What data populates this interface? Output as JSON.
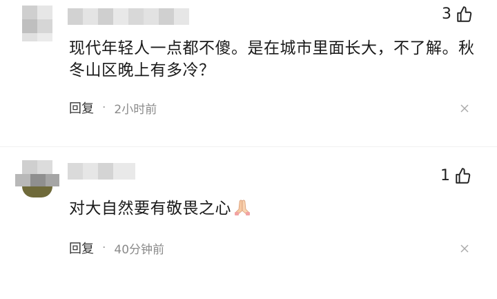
{
  "comments": [
    {
      "likes": "3",
      "text": "现代年轻人一点都不傻。是在城市里面长大，不了解。秋冬山区晚上有多冷？",
      "text_lines": [
        "现代年轻人一点都不傻。是在城市里面长大，不了解。秋",
        "冬山区晚上有多冷？"
      ],
      "reply_label": "回复",
      "separator": "·",
      "time": "2小时前"
    },
    {
      "likes": "1",
      "text": "对大自然要有敬畏之心",
      "emoji": "praying-hands",
      "reply_label": "回复",
      "separator": "·",
      "time": "40分钟前"
    }
  ],
  "icons": {
    "like": "thumbs-up-outline-icon",
    "close": "close-icon"
  },
  "colors": {
    "text": "#1a1a1a",
    "meta": "#8a8a8a",
    "blur_gray": "#d9d9d9"
  }
}
